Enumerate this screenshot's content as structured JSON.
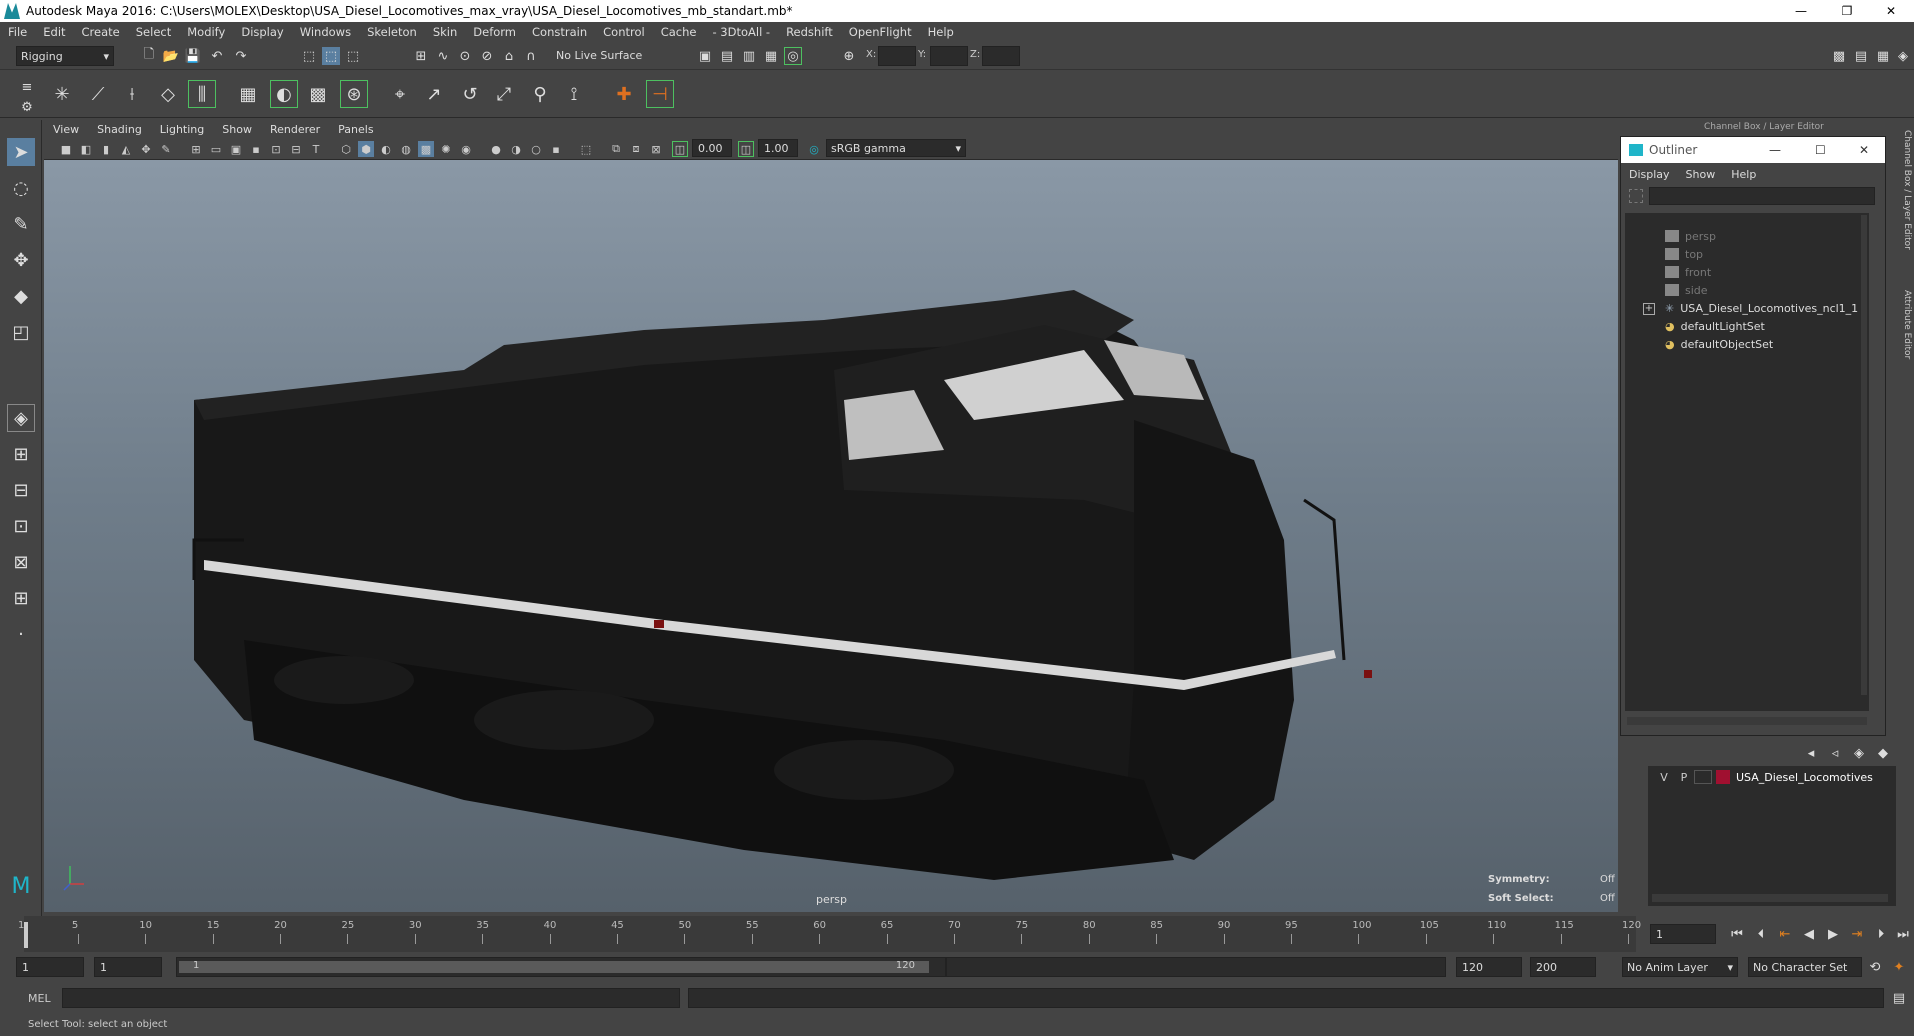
{
  "window": {
    "title": "Autodesk Maya 2016: C:\\Users\\MOLEX\\Desktop\\USA_Diesel_Locomotives_max_vray\\USA_Diesel_Locomotives_mb_standart.mb*",
    "minimize": "—",
    "maximize": "❐",
    "close": "✕"
  },
  "menubar": [
    "File",
    "Edit",
    "Create",
    "Select",
    "Modify",
    "Display",
    "Windows",
    "Skeleton",
    "Skin",
    "Deform",
    "Constrain",
    "Control",
    "Cache",
    "- 3DtoAll -",
    "Redshift",
    "OpenFlight",
    "Help"
  ],
  "statusline": {
    "menuset": "Rigging",
    "live_surface": "No Live Surface",
    "x_label": "X:",
    "y_label": "Y:",
    "z_label": "Z:"
  },
  "panel": {
    "menus": [
      "View",
      "Shading",
      "Lighting",
      "Show",
      "Renderer",
      "Panels"
    ],
    "exposure": "0.00",
    "gamma": "1.00",
    "colorspace": "sRGB gamma"
  },
  "viewport": {
    "camera": "persp",
    "symmetry_label": "Symmetry:",
    "symmetry_value": "Off",
    "soft_select_label": "Soft Select:",
    "soft_select_value": "Off"
  },
  "right_panel": {
    "channel_box_title": "Channel Box / Layer Editor",
    "side_tab_1": "Channel Box / Layer Editor",
    "side_tab_2": "Attribute Editor"
  },
  "outliner": {
    "title": "Outliner",
    "menus": [
      "Display",
      "Show",
      "Help"
    ],
    "items": [
      {
        "label": "persp",
        "kind": "camera",
        "dim": true
      },
      {
        "label": "top",
        "kind": "camera",
        "dim": true
      },
      {
        "label": "front",
        "kind": "camera",
        "dim": true
      },
      {
        "label": "side",
        "kind": "camera",
        "dim": true
      },
      {
        "label": "USA_Diesel_Locomotives_ncl1_1",
        "kind": "group",
        "dim": false
      },
      {
        "label": "defaultLightSet",
        "kind": "set",
        "dim": false
      },
      {
        "label": "defaultObjectSet",
        "kind": "set",
        "dim": false
      }
    ]
  },
  "layer_editor": {
    "visible": "V",
    "playback": "P",
    "layer_name": "USA_Diesel_Locomotives",
    "layer_color": "#a01030"
  },
  "timeline": {
    "ticks": [
      1,
      5,
      10,
      15,
      20,
      25,
      30,
      35,
      40,
      45,
      50,
      55,
      60,
      65,
      70,
      75,
      80,
      85,
      90,
      95,
      100,
      105,
      110,
      115,
      120
    ],
    "current_frame": "1"
  },
  "range": {
    "start": "1",
    "start_inner": "1",
    "slider_start": "1",
    "slider_end": "120",
    "end_inner": "120",
    "end": "200",
    "anim_layer": "No Anim Layer",
    "character_set": "No Character Set"
  },
  "cmdline": {
    "label": "MEL"
  },
  "helpline": {
    "text": "Select Tool: select an object"
  }
}
